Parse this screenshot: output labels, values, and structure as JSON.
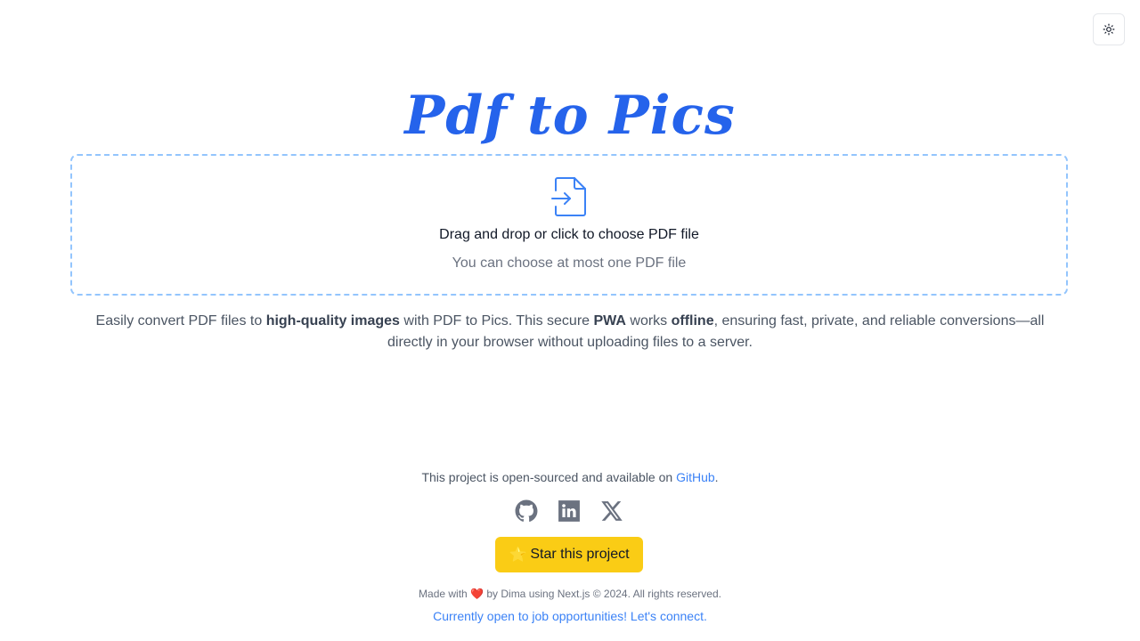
{
  "app": {
    "title": "Pdf to Pics"
  },
  "header": {
    "theme_toggle_icon": "sun-icon"
  },
  "dropzone": {
    "icon": "file-import-icon",
    "main_text": "Drag and drop or click to choose PDF file",
    "sub_text": "You can choose at most one PDF file"
  },
  "description": {
    "part1": "Easily convert PDF files to ",
    "bold1": "high-quality images",
    "part2": " with PDF to Pics. This secure ",
    "bold2": "PWA",
    "part3": " works ",
    "bold3": "offline",
    "part4": ", ensuring fast, private, and reliable conversions—all directly in your browser without uploading files to a server."
  },
  "footer": {
    "opensource_prefix": "This project is open-sourced and available on ",
    "github_link": "GitHub",
    "opensource_suffix": ".",
    "socials": [
      "github-icon",
      "linkedin-icon",
      "x-icon"
    ],
    "star_emoji": "⭐",
    "star_label": "Star this project",
    "made_prefix": "Made with ",
    "heart": "❤️",
    "made_suffix": " by Dima using Next.js © 2024. All rights reserved.",
    "job_link": "Currently open to job opportunities! Let's connect."
  },
  "colors": {
    "accent": "#2563eb",
    "link": "#3b82f6",
    "star_button": "#facc15",
    "dropzone_border": "#93c5fd"
  }
}
